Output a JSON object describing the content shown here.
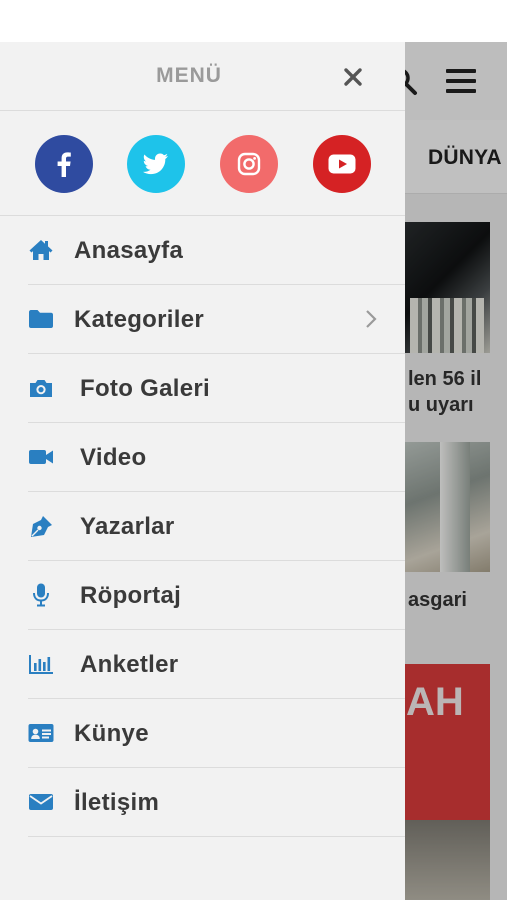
{
  "background_app": {
    "tab_label": "DÜNYA",
    "news_snippets": [
      "len 56 il",
      "u uyarı",
      "asgari"
    ],
    "image3_text": "AH"
  },
  "drawer": {
    "title": "MENÜ",
    "social": [
      "facebook",
      "twitter",
      "instagram",
      "youtube"
    ],
    "items": [
      {
        "label": "Anasayfa",
        "icon": "home-icon"
      },
      {
        "label": "Kategoriler",
        "icon": "folder-icon",
        "has_submenu": true
      },
      {
        "label": "Foto Galeri",
        "icon": "camera-icon"
      },
      {
        "label": "Video",
        "icon": "video-icon"
      },
      {
        "label": "Yazarlar",
        "icon": "pen-icon"
      },
      {
        "label": "Röportaj",
        "icon": "microphone-icon"
      },
      {
        "label": "Anketler",
        "icon": "poll-chart-icon"
      },
      {
        "label": "Künye",
        "icon": "id-card-icon"
      },
      {
        "label": "İletişim",
        "icon": "envelope-icon"
      }
    ]
  },
  "colors": {
    "accent_blue": "#2a7fc1",
    "facebook": "#2f4ba0",
    "twitter": "#1ec3ea",
    "instagram": "#f26b6b",
    "youtube": "#d52224"
  }
}
